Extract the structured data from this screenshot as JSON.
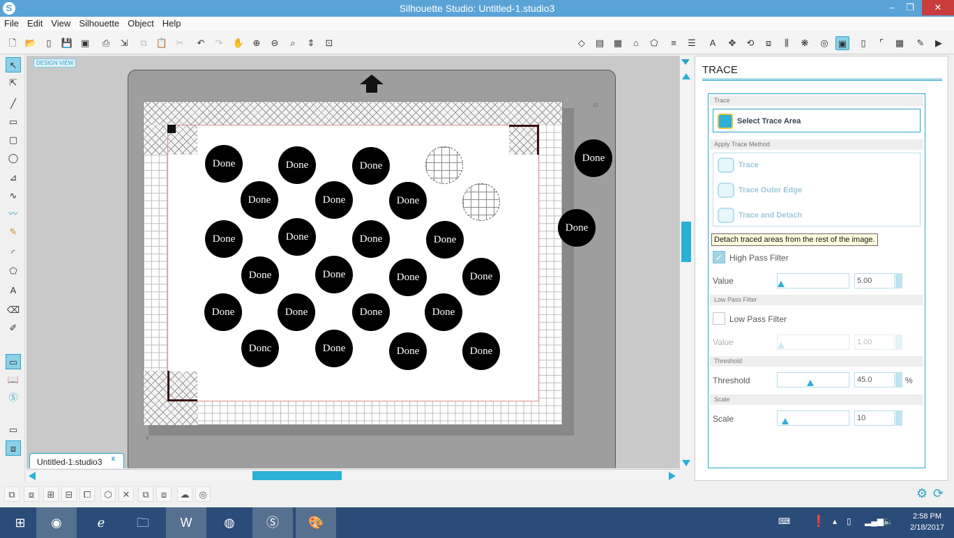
{
  "window": {
    "title": "Silhouette Studio: Untitled-1.studio3",
    "logo": "S",
    "minimize": "–",
    "restore": "❐",
    "close": "✕"
  },
  "menu": [
    "File",
    "Edit",
    "View",
    "Silhouette",
    "Object",
    "Help"
  ],
  "canvas": {
    "design_view_label": "DESIGN VIEW",
    "document_tab": "Untitled-1.studio3",
    "document_tab_close": "x",
    "mat_number_right": "12",
    "mat_number_left": "9"
  },
  "shapes": [
    {
      "label": "Done"
    },
    {
      "label": "Done"
    },
    {
      "label": "Done"
    },
    {
      "label": ""
    },
    {
      "label": "Done"
    },
    {
      "label": "Done"
    },
    {
      "label": "Done"
    },
    {
      "label": ""
    },
    {
      "label": "Done"
    },
    {
      "label": "Done"
    },
    {
      "label": "Done"
    },
    {
      "label": "Done"
    },
    {
      "label": "Done"
    },
    {
      "label": "Done"
    },
    {
      "label": "Done"
    },
    {
      "label": "Done"
    },
    {
      "label": "Done"
    },
    {
      "label": "Done"
    },
    {
      "label": "Done"
    },
    {
      "label": "Done"
    },
    {
      "label": "Donc"
    },
    {
      "label": "Done"
    },
    {
      "label": "Done"
    },
    {
      "label": "Done"
    },
    {
      "label": "Done"
    },
    {
      "label": "Done"
    }
  ],
  "panel": {
    "title": "TRACE",
    "trace_section": "Trace",
    "select_trace_area": "Select Trace Area",
    "apply_method_section": "Apply Trace Method",
    "method_trace": "Trace",
    "method_outer_edge": "Trace Outer Edge",
    "method_detach": "Trace and Detach",
    "tooltip": "Detach traced areas from the rest of the image.",
    "high_pass_label": "High Pass Filter",
    "high_pass_checked": true,
    "value_label": "Value",
    "high_pass_value": "5.00",
    "low_pass_section": "Low Pass Filter",
    "low_pass_label": "Low Pass Filter",
    "low_pass_checked": false,
    "low_pass_value_label": "Value",
    "low_pass_value": "1.00",
    "threshold_section": "Threshold",
    "threshold_label": "Threshold",
    "threshold_value": "45.0",
    "threshold_unit": "%",
    "scale_section": "Scale",
    "scale_label": "Scale",
    "scale_value": "10"
  },
  "taskbar": {
    "time": "2:58 PM",
    "date": "2/18/2017"
  },
  "colors": {
    "accent": "#2bb0d8",
    "titlebar": "#5aa3d6",
    "taskbar": "#2b4b79",
    "close": "#c83c3c"
  }
}
